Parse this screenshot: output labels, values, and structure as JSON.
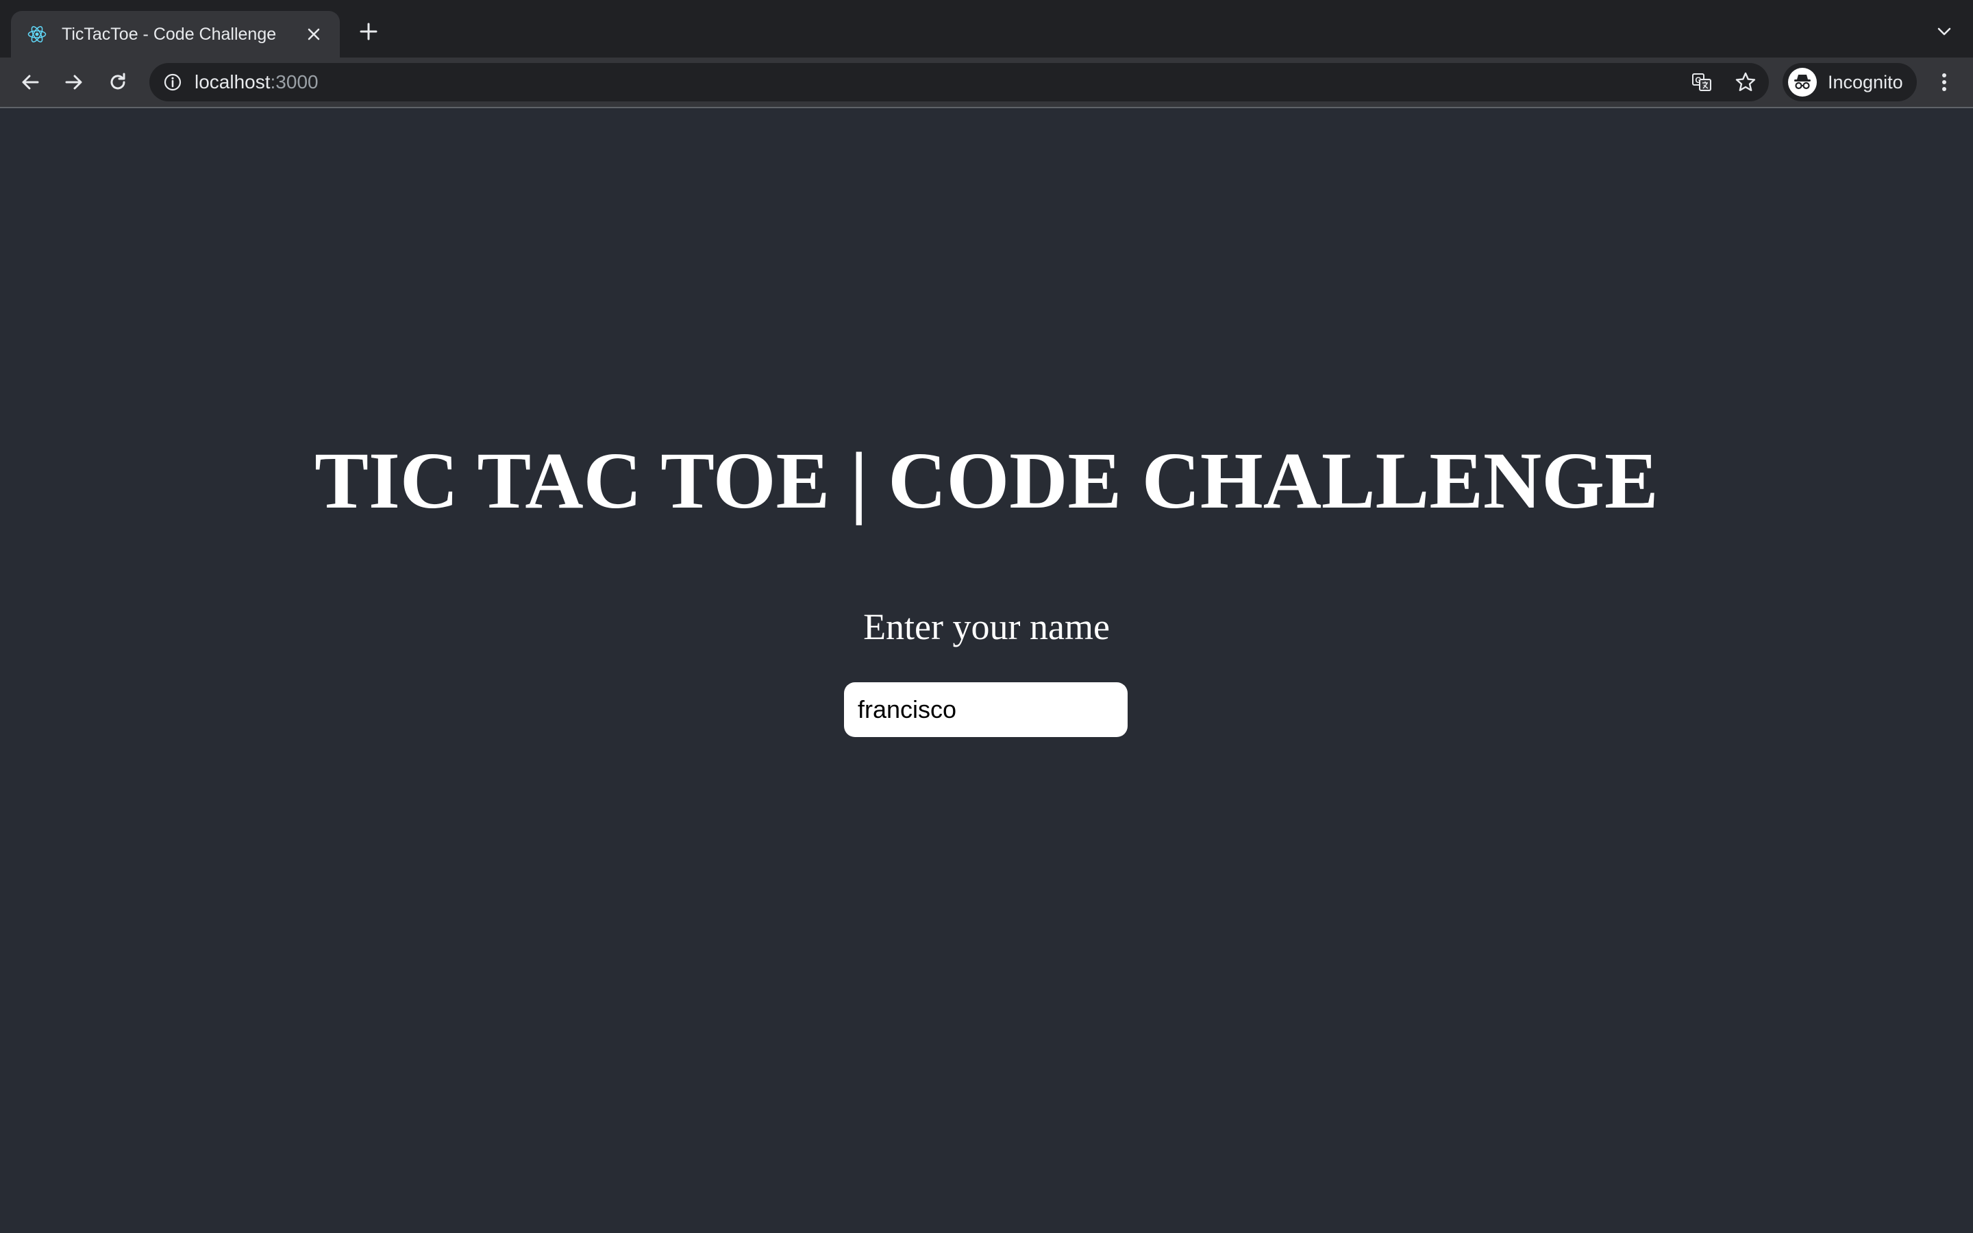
{
  "browser": {
    "tab": {
      "title": "TicTacToe - Code Challenge",
      "favicon": "react-logo-icon"
    },
    "url": {
      "host": "localhost",
      "port": ":3000"
    },
    "profile": {
      "label": "Incognito",
      "icon": "incognito-icon"
    },
    "colors": {
      "tabstrip": "#202124",
      "toolbar": "#35363a",
      "favicon_accent": "#61dafb"
    }
  },
  "page": {
    "title": "TIC TAC TOE | CODE CHALLENGE",
    "prompt": "Enter your name",
    "name_input": {
      "value": "francisco",
      "placeholder": ""
    },
    "colors": {
      "background": "#282c34",
      "text": "#ffffff"
    }
  }
}
